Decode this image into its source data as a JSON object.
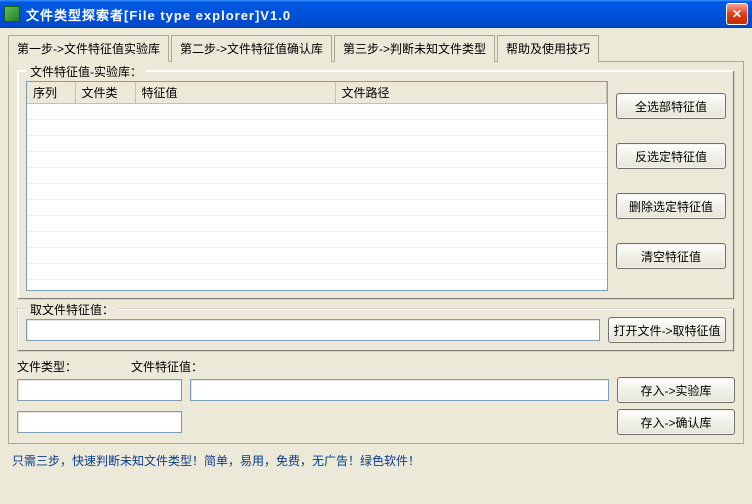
{
  "window": {
    "title": "文件类型探索者[File type explorer]V1.0"
  },
  "tabs": [
    "第一步->文件特征值实验库",
    "第二步->文件特征值确认库",
    "第三步->判断未知文件类型",
    "帮助及使用技巧"
  ],
  "group1": {
    "legend": "文件特征值-实验库："
  },
  "table": {
    "columns": [
      "序列",
      "文件类",
      "特征值",
      "文件路径"
    ],
    "rows": []
  },
  "sideButtons": {
    "selectAll": "全选部特征值",
    "invert": "反选定特征值",
    "deleteSel": "删除选定特征值",
    "clear": "清空特征值"
  },
  "group2": {
    "legend": "取文件特征值："
  },
  "openFileBtn": "打开文件->取特征值",
  "label_fileType": "文件类型：",
  "label_featureValue": "文件特征值：",
  "saveLabBtn": "存入->实验库",
  "saveConfirmBtn": "存入->确认库",
  "footer": "只需三步，快速判断未知文件类型！简单，易用，免费，无广告！绿色软件！",
  "inputs": {
    "mainPath": "",
    "fileType": "",
    "featureValue": "",
    "extra": ""
  }
}
